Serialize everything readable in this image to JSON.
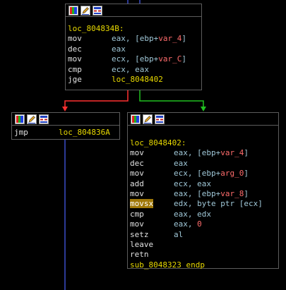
{
  "colors": {
    "background": "#000000",
    "node_border": "#5c5c5c",
    "label": "#e8d900",
    "mnemonic": "#e0e0e0",
    "operand": "#a0c8d8",
    "variable": "#ff6c6c",
    "edge_false": "#ff3030",
    "edge_true": "#20c020",
    "edge_uncond": "#3a4ec8",
    "highlight": "#a07808"
  },
  "header_icons": [
    "color-palette-icon",
    "edit-pencil-icon",
    "graph-view-icon"
  ],
  "node_top": {
    "label": "loc_804834B:",
    "lines": [
      {
        "mn": "mov",
        "pre": "eax, [ebp+",
        "var": "var_4",
        "post": "]"
      },
      {
        "mn": "dec",
        "pre": "eax"
      },
      {
        "mn": "mov",
        "pre": "ecx, [ebp+",
        "var": "var_C",
        "post": "]"
      },
      {
        "mn": "cmp",
        "pre": "ecx, eax"
      },
      {
        "mn": "jge",
        "target": "loc_8048402"
      }
    ]
  },
  "node_left": {
    "mn": "jmp",
    "target": "loc_804836A"
  },
  "node_right": {
    "label": "loc_8048402:",
    "lines": [
      {
        "mn": "mov",
        "pre": "eax, [ebp+",
        "var": "var_4",
        "post": "]"
      },
      {
        "mn": "dec",
        "pre": "eax"
      },
      {
        "mn": "mov",
        "pre": "ecx, [ebp+",
        "var": "arg_0",
        "post": "]"
      },
      {
        "mn": "add",
        "pre": "ecx, eax"
      },
      {
        "mn": "mov",
        "pre": "eax, [ebp+",
        "var": "var_8",
        "post": "]"
      },
      {
        "mn": "movsx",
        "pre": "edx, byte ptr [ecx]",
        "highlight": true
      },
      {
        "mn": "cmp",
        "pre": "eax, edx"
      },
      {
        "mn": "mov",
        "pre": "eax, ",
        "num": "0"
      },
      {
        "mn": "setz",
        "pre": "al"
      },
      {
        "mn": "leave"
      },
      {
        "mn": "retn"
      }
    ],
    "endp": {
      "name": "sub_8048323",
      "keyword": "endp"
    }
  }
}
